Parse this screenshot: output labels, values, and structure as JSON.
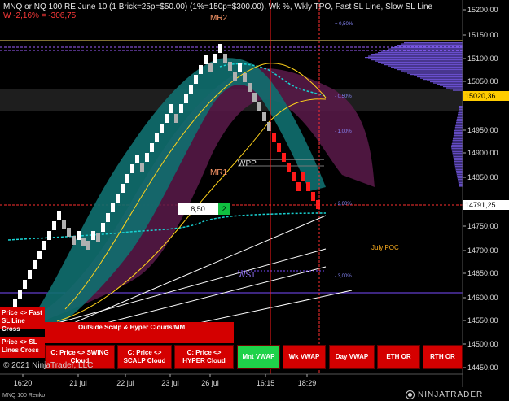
{
  "header": {
    "title": "MNQ or NQ 100 RE June 10 (1 Brick=25p=$50.00) (1%=150p=$300.00), Wk %, Wkly TPO, Fast SL Line, Slow SL Line",
    "performance": "W -2,16% = -306,75"
  },
  "labels": {
    "mr2": "MR2",
    "mr1": "MR1",
    "wpp": "WPP",
    "ws1": "WS1",
    "july_poc": "July POC",
    "pct_p050": "+ 0,50%",
    "pct_m050": "- 0,50%",
    "pct_m100": "- 1,00%",
    "pct_m200": "- 2,00%",
    "pct_m300": "- 3,00%"
  },
  "y_axis": {
    "ticks": [
      "15200,00",
      "15150,00",
      "15100,00",
      "15050,00",
      "14950,00",
      "14900,00",
      "14850,00",
      "14750,00",
      "14700,00",
      "14650,00",
      "14600,00",
      "14550,00",
      "14500,00",
      "14450,00"
    ],
    "current_price": "15020,36",
    "last_price": "14791,25"
  },
  "x_axis": {
    "ticks": [
      "16:20",
      "21 jul",
      "22 jul",
      "23 jul",
      "26 jul",
      "16:15",
      "18:29"
    ]
  },
  "info_box": {
    "value": "8,50",
    "count": "2"
  },
  "buttons": {
    "price_fast": "Price <> Fast SL Line Cross",
    "price_sl": "Price <> SL Lines Cross",
    "outside": "Outside Scalp & Hyper Clouds/MM",
    "swing": "C: Price <> SWING Cloud",
    "scalp": "C: Price <> SCALP Cloud",
    "hyper": "C: Price <> HYPER Cloud",
    "mnt_vwap": "Mnt VWAP",
    "wk_vwap": "Wk VWAP",
    "day_vwap": "Day VWAP",
    "eth_or": "ETH OR",
    "rth_or": "RTH OR"
  },
  "footer": {
    "copyright": "© 2021 NinjaTrader, LLC",
    "instrument": "MNQ 100 Renko",
    "brand": "NINJATRADER"
  },
  "colors": {
    "up_brick": "#ffffff",
    "down_brick": "#ff1a1a",
    "neutral_brick": "#b0b0b0",
    "cloud_teal": "#0f6f6f",
    "cloud_magenta": "#5a1a4a",
    "vwap": "#19d3d3",
    "fast_line": "#ffd21a",
    "slow_line": "#ffd21a",
    "current_price_bg": "#ffcc00"
  }
}
